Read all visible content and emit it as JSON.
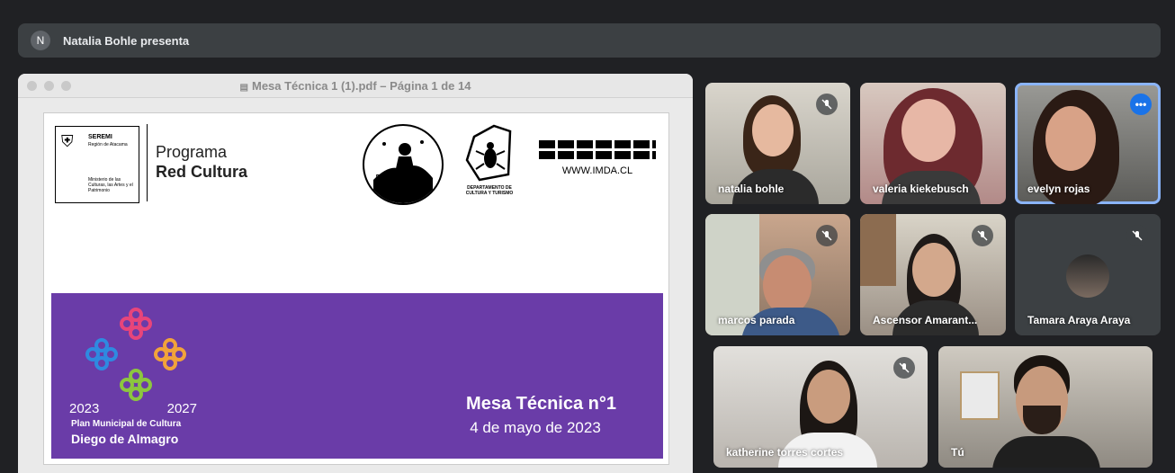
{
  "presenter_bar": {
    "avatar_initial": "N",
    "title": "Natalia Bohle presenta"
  },
  "pdf_window": {
    "title": "Mesa Técnica 1 (1).pdf – Página 1 de 14",
    "slide": {
      "seremi_title": "SEREMI",
      "seremi_region": "Región de Atacama",
      "seremi_ministry": "Ministerio de las Culturas, las Artes y el Patrimonio",
      "program_line1": "Programa",
      "program_line2": "Red Cultura",
      "logo_diego_almagro": "DIEGO ALMAGRO",
      "dept_label": "DEPARTAMENTO DE CULTURA Y TURISMO",
      "imda_url": "WWW.IMDA.CL",
      "year_start": "2023",
      "year_end": "2027",
      "plan_label": "Plan Municipal de Cultura",
      "plan_city": "Diego de Almagro",
      "meeting_title": "Mesa Técnica n°1",
      "meeting_date": "4 de mayo de 2023"
    }
  },
  "participants": [
    {
      "name": "natalia bohle",
      "muted": true
    },
    {
      "name": "valeria kiekebusch",
      "muted": false
    },
    {
      "name": "evelyn rojas",
      "muted": false,
      "more_options": true,
      "active_speaker": true
    },
    {
      "name": "marcos parada",
      "muted": true
    },
    {
      "name": "Ascensor Amarant...",
      "muted": true
    },
    {
      "name": "Tamara Araya Araya",
      "muted": true
    },
    {
      "name": "katherine torres cortes",
      "muted": true
    },
    {
      "name": "Tú",
      "muted": false
    }
  ],
  "colors": {
    "page_bg": "#202124",
    "bar_bg": "#3c4043",
    "accent_blue": "#1a73e8",
    "slide_purple": "#6a3ca8"
  }
}
